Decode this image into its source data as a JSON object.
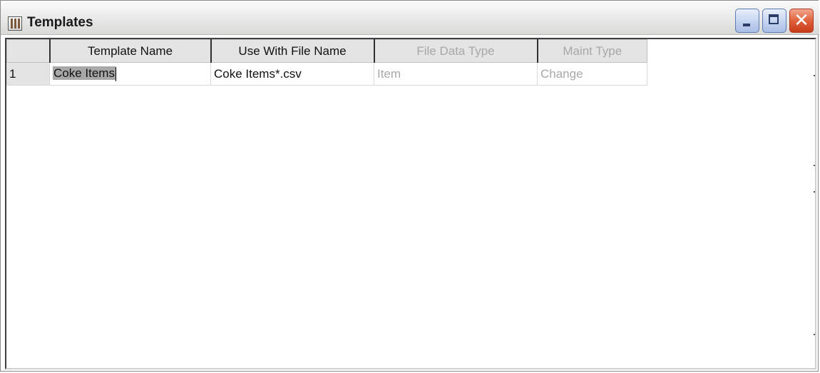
{
  "window": {
    "title": "Templates"
  },
  "title_buttons": {
    "minimize": "minimize-icon",
    "maximize": "maximize-icon",
    "close": "close-icon",
    "close_color": "#e0613c",
    "close_glyph": "✕"
  },
  "grid": {
    "headers": {
      "template_name": "Template Name",
      "use_with_file_name": "Use With File Name",
      "file_data_type": "File Data Type",
      "maint_type": "Maint Type"
    },
    "rows": [
      {
        "number": "1",
        "template_name": "Coke Items",
        "use_with_file_name": "Coke Items*.csv",
        "file_data_type": "Item",
        "maint_type": "Change"
      }
    ]
  }
}
